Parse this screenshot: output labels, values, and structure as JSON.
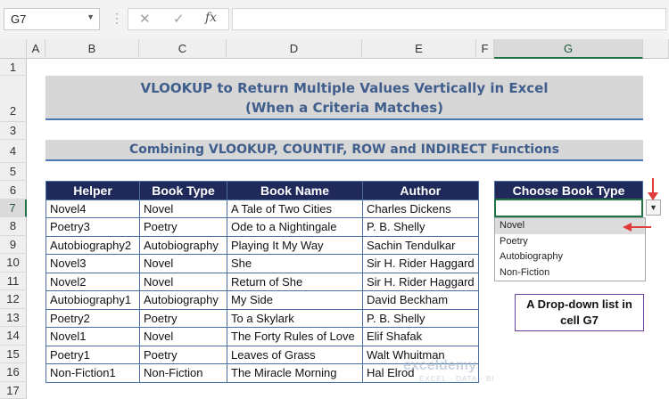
{
  "formula_bar": {
    "name_box": "G7",
    "sep": "⋮",
    "icons": {
      "cancel": "✕",
      "enter": "✓",
      "fx": "fx"
    },
    "formula": ""
  },
  "columns": [
    "A",
    "B",
    "C",
    "D",
    "E",
    "F",
    "G"
  ],
  "rows": [
    "1",
    "2",
    "3",
    "4",
    "5",
    "6",
    "7",
    "8",
    "9",
    "10",
    "11",
    "12",
    "13",
    "14",
    "15",
    "16",
    "17"
  ],
  "title": {
    "line1": "VLOOKUP to Return Multiple Values Vertically in Excel",
    "line2": "(When a Criteria Matches)"
  },
  "subtitle": "Combining VLOOKUP, COUNTIF, ROW and INDIRECT Functions",
  "table": {
    "headers": [
      "Helper",
      "Book Type",
      "Book Name",
      "Author"
    ],
    "rows": [
      [
        "Novel4",
        "Novel",
        "A Tale of Two Cities",
        "Charles Dickens"
      ],
      [
        "Poetry3",
        "Poetry",
        "Ode to a Nightingale",
        "P. B. Shelly"
      ],
      [
        "Autobiography2",
        "Autobiography",
        "Playing It My Way",
        "Sachin Tendulkar"
      ],
      [
        "Novel3",
        "Novel",
        "She",
        "Sir H. Rider Haggard"
      ],
      [
        "Novel2",
        "Novel",
        "Return of She",
        "Sir H. Rider Haggard"
      ],
      [
        "Autobiography1",
        "Autobiography",
        "My Side",
        "David Beckham"
      ],
      [
        "Poetry2",
        "Poetry",
        "To a Skylark",
        "P. B. Shelly"
      ],
      [
        "Novel1",
        "Novel",
        "The Forty Rules of Love",
        "Elif Shafak"
      ],
      [
        "Poetry1",
        "Poetry",
        "Leaves of Grass",
        "Walt Whuitman"
      ],
      [
        "Non-Fiction1",
        "Non-Fiction",
        "The Miracle Morning",
        "Hal Elrod"
      ]
    ]
  },
  "choose": {
    "header": "Choose Book Type",
    "value": "",
    "options": [
      "Novel",
      "Poetry",
      "Autobiography",
      "Non-Fiction"
    ]
  },
  "note": {
    "line1": "A Drop-down list in",
    "line2": "cell G7"
  },
  "watermark": {
    "main": "exceldemy",
    "sub": "EXCEL · DATA · BI"
  },
  "colors": {
    "header_bg": "#1f2a5a",
    "title_text": "#3f5e8c",
    "accent_green": "#217346",
    "arrow_red": "#e03c3c"
  }
}
